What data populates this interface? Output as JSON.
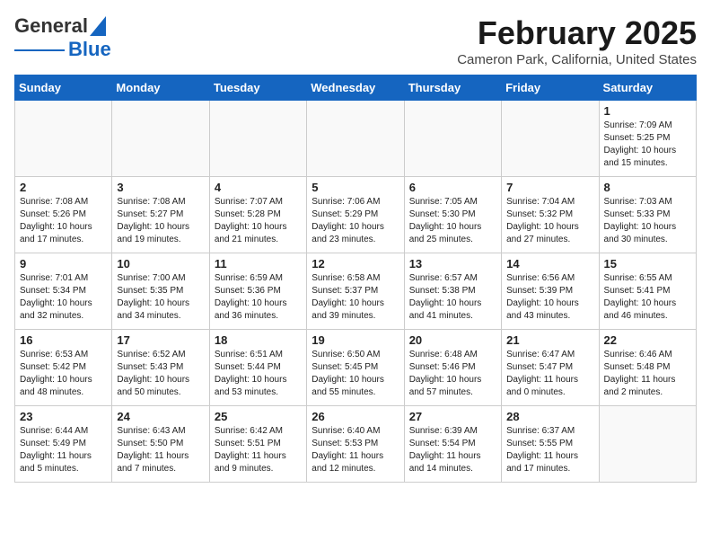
{
  "header": {
    "logo_general": "General",
    "logo_blue": "Blue",
    "month_title": "February 2025",
    "location": "Cameron Park, California, United States"
  },
  "days_of_week": [
    "Sunday",
    "Monday",
    "Tuesday",
    "Wednesday",
    "Thursday",
    "Friday",
    "Saturday"
  ],
  "weeks": [
    [
      {
        "day": "",
        "info": ""
      },
      {
        "day": "",
        "info": ""
      },
      {
        "day": "",
        "info": ""
      },
      {
        "day": "",
        "info": ""
      },
      {
        "day": "",
        "info": ""
      },
      {
        "day": "",
        "info": ""
      },
      {
        "day": "1",
        "info": "Sunrise: 7:09 AM\nSunset: 5:25 PM\nDaylight: 10 hours and 15 minutes."
      }
    ],
    [
      {
        "day": "2",
        "info": "Sunrise: 7:08 AM\nSunset: 5:26 PM\nDaylight: 10 hours and 17 minutes."
      },
      {
        "day": "3",
        "info": "Sunrise: 7:08 AM\nSunset: 5:27 PM\nDaylight: 10 hours and 19 minutes."
      },
      {
        "day": "4",
        "info": "Sunrise: 7:07 AM\nSunset: 5:28 PM\nDaylight: 10 hours and 21 minutes."
      },
      {
        "day": "5",
        "info": "Sunrise: 7:06 AM\nSunset: 5:29 PM\nDaylight: 10 hours and 23 minutes."
      },
      {
        "day": "6",
        "info": "Sunrise: 7:05 AM\nSunset: 5:30 PM\nDaylight: 10 hours and 25 minutes."
      },
      {
        "day": "7",
        "info": "Sunrise: 7:04 AM\nSunset: 5:32 PM\nDaylight: 10 hours and 27 minutes."
      },
      {
        "day": "8",
        "info": "Sunrise: 7:03 AM\nSunset: 5:33 PM\nDaylight: 10 hours and 30 minutes."
      }
    ],
    [
      {
        "day": "9",
        "info": "Sunrise: 7:01 AM\nSunset: 5:34 PM\nDaylight: 10 hours and 32 minutes."
      },
      {
        "day": "10",
        "info": "Sunrise: 7:00 AM\nSunset: 5:35 PM\nDaylight: 10 hours and 34 minutes."
      },
      {
        "day": "11",
        "info": "Sunrise: 6:59 AM\nSunset: 5:36 PM\nDaylight: 10 hours and 36 minutes."
      },
      {
        "day": "12",
        "info": "Sunrise: 6:58 AM\nSunset: 5:37 PM\nDaylight: 10 hours and 39 minutes."
      },
      {
        "day": "13",
        "info": "Sunrise: 6:57 AM\nSunset: 5:38 PM\nDaylight: 10 hours and 41 minutes."
      },
      {
        "day": "14",
        "info": "Sunrise: 6:56 AM\nSunset: 5:39 PM\nDaylight: 10 hours and 43 minutes."
      },
      {
        "day": "15",
        "info": "Sunrise: 6:55 AM\nSunset: 5:41 PM\nDaylight: 10 hours and 46 minutes."
      }
    ],
    [
      {
        "day": "16",
        "info": "Sunrise: 6:53 AM\nSunset: 5:42 PM\nDaylight: 10 hours and 48 minutes."
      },
      {
        "day": "17",
        "info": "Sunrise: 6:52 AM\nSunset: 5:43 PM\nDaylight: 10 hours and 50 minutes."
      },
      {
        "day": "18",
        "info": "Sunrise: 6:51 AM\nSunset: 5:44 PM\nDaylight: 10 hours and 53 minutes."
      },
      {
        "day": "19",
        "info": "Sunrise: 6:50 AM\nSunset: 5:45 PM\nDaylight: 10 hours and 55 minutes."
      },
      {
        "day": "20",
        "info": "Sunrise: 6:48 AM\nSunset: 5:46 PM\nDaylight: 10 hours and 57 minutes."
      },
      {
        "day": "21",
        "info": "Sunrise: 6:47 AM\nSunset: 5:47 PM\nDaylight: 11 hours and 0 minutes."
      },
      {
        "day": "22",
        "info": "Sunrise: 6:46 AM\nSunset: 5:48 PM\nDaylight: 11 hours and 2 minutes."
      }
    ],
    [
      {
        "day": "23",
        "info": "Sunrise: 6:44 AM\nSunset: 5:49 PM\nDaylight: 11 hours and 5 minutes."
      },
      {
        "day": "24",
        "info": "Sunrise: 6:43 AM\nSunset: 5:50 PM\nDaylight: 11 hours and 7 minutes."
      },
      {
        "day": "25",
        "info": "Sunrise: 6:42 AM\nSunset: 5:51 PM\nDaylight: 11 hours and 9 minutes."
      },
      {
        "day": "26",
        "info": "Sunrise: 6:40 AM\nSunset: 5:53 PM\nDaylight: 11 hours and 12 minutes."
      },
      {
        "day": "27",
        "info": "Sunrise: 6:39 AM\nSunset: 5:54 PM\nDaylight: 11 hours and 14 minutes."
      },
      {
        "day": "28",
        "info": "Sunrise: 6:37 AM\nSunset: 5:55 PM\nDaylight: 11 hours and 17 minutes."
      },
      {
        "day": "",
        "info": ""
      }
    ]
  ]
}
